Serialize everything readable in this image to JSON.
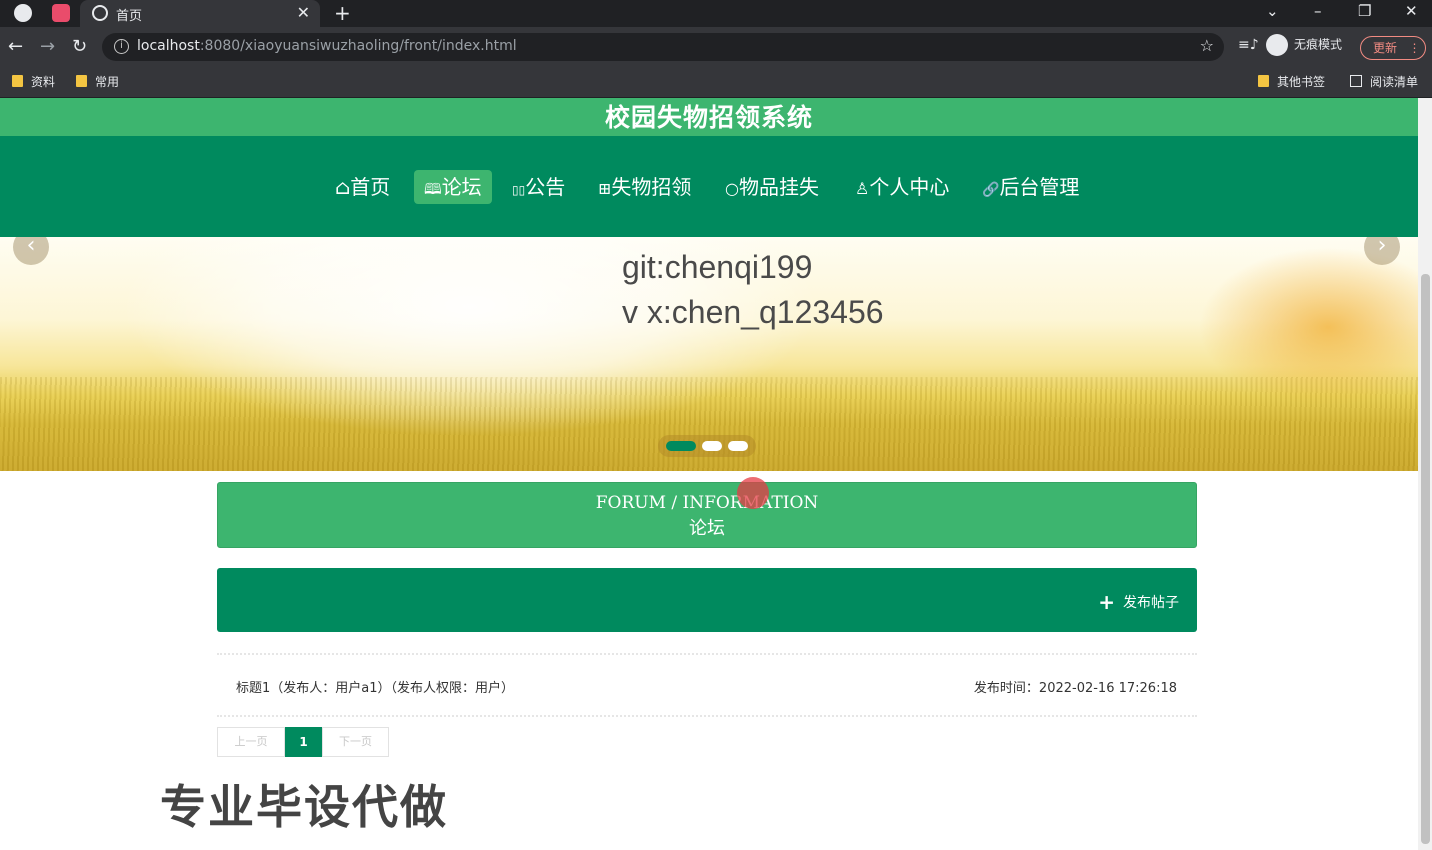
{
  "browser": {
    "active_tab_title": "首页",
    "url_host": "localhost",
    "url_rest": ":8080/xiaoyuansiwuzhaoling/front/index.html",
    "incognito_label": "无痕模式",
    "update_label": "更新",
    "bookmarks": [
      "资料",
      "常用"
    ],
    "bookmarks_right": [
      "其他书签",
      "阅读清单"
    ]
  },
  "site": {
    "title": "校园失物招领系统"
  },
  "nav": {
    "items": [
      {
        "icon": "⌂",
        "label": "首页"
      },
      {
        "icon": "🕮",
        "label": "论坛"
      },
      {
        "icon": "▯▯",
        "label": "公告"
      },
      {
        "icon": "⊞",
        "label": "失物招领"
      },
      {
        "icon": "○",
        "label": "物品挂失"
      },
      {
        "icon": "♙",
        "label": "个人中心"
      },
      {
        "icon": "🔗",
        "label": "后台管理"
      }
    ],
    "active": "论坛"
  },
  "banner": {
    "line1": "git:chenqi199",
    "line2": "v x:chen_q123456",
    "slides": 3,
    "active_slide": 1
  },
  "section": {
    "en_title": "FORUM / INFORMATION",
    "cn_title": "论坛"
  },
  "toolbar": {
    "post_label": "发布帖子"
  },
  "posts": [
    {
      "summary": "标题1（发布人：用户a1）（发布人权限：用户）",
      "time_label": "发布时间：2022-02-16 17:26:18"
    }
  ],
  "pager": {
    "prev": "上一页",
    "current": "1",
    "next": "下一页"
  },
  "watermark": "专业毕设代做",
  "icons": {
    "back": "arrow-left-icon",
    "forward": "arrow-right-icon",
    "reload": "reload-icon",
    "bookmark_star": "star-icon"
  }
}
